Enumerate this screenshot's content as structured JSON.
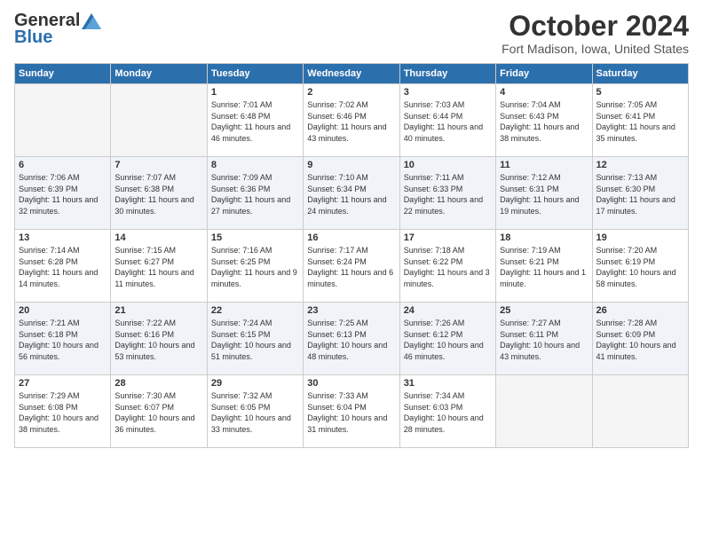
{
  "header": {
    "logo_general": "General",
    "logo_blue": "Blue",
    "month_title": "October 2024",
    "location": "Fort Madison, Iowa, United States"
  },
  "days_of_week": [
    "Sunday",
    "Monday",
    "Tuesday",
    "Wednesday",
    "Thursday",
    "Friday",
    "Saturday"
  ],
  "weeks": [
    [
      {
        "day": "",
        "empty": true
      },
      {
        "day": "",
        "empty": true
      },
      {
        "day": "1",
        "sunrise": "7:01 AM",
        "sunset": "6:48 PM",
        "daylight": "11 hours and 46 minutes."
      },
      {
        "day": "2",
        "sunrise": "7:02 AM",
        "sunset": "6:46 PM",
        "daylight": "11 hours and 43 minutes."
      },
      {
        "day": "3",
        "sunrise": "7:03 AM",
        "sunset": "6:44 PM",
        "daylight": "11 hours and 40 minutes."
      },
      {
        "day": "4",
        "sunrise": "7:04 AM",
        "sunset": "6:43 PM",
        "daylight": "11 hours and 38 minutes."
      },
      {
        "day": "5",
        "sunrise": "7:05 AM",
        "sunset": "6:41 PM",
        "daylight": "11 hours and 35 minutes."
      }
    ],
    [
      {
        "day": "6",
        "sunrise": "7:06 AM",
        "sunset": "6:39 PM",
        "daylight": "11 hours and 32 minutes."
      },
      {
        "day": "7",
        "sunrise": "7:07 AM",
        "sunset": "6:38 PM",
        "daylight": "11 hours and 30 minutes."
      },
      {
        "day": "8",
        "sunrise": "7:09 AM",
        "sunset": "6:36 PM",
        "daylight": "11 hours and 27 minutes."
      },
      {
        "day": "9",
        "sunrise": "7:10 AM",
        "sunset": "6:34 PM",
        "daylight": "11 hours and 24 minutes."
      },
      {
        "day": "10",
        "sunrise": "7:11 AM",
        "sunset": "6:33 PM",
        "daylight": "11 hours and 22 minutes."
      },
      {
        "day": "11",
        "sunrise": "7:12 AM",
        "sunset": "6:31 PM",
        "daylight": "11 hours and 19 minutes."
      },
      {
        "day": "12",
        "sunrise": "7:13 AM",
        "sunset": "6:30 PM",
        "daylight": "11 hours and 17 minutes."
      }
    ],
    [
      {
        "day": "13",
        "sunrise": "7:14 AM",
        "sunset": "6:28 PM",
        "daylight": "11 hours and 14 minutes."
      },
      {
        "day": "14",
        "sunrise": "7:15 AM",
        "sunset": "6:27 PM",
        "daylight": "11 hours and 11 minutes."
      },
      {
        "day": "15",
        "sunrise": "7:16 AM",
        "sunset": "6:25 PM",
        "daylight": "11 hours and 9 minutes."
      },
      {
        "day": "16",
        "sunrise": "7:17 AM",
        "sunset": "6:24 PM",
        "daylight": "11 hours and 6 minutes."
      },
      {
        "day": "17",
        "sunrise": "7:18 AM",
        "sunset": "6:22 PM",
        "daylight": "11 hours and 3 minutes."
      },
      {
        "day": "18",
        "sunrise": "7:19 AM",
        "sunset": "6:21 PM",
        "daylight": "11 hours and 1 minute."
      },
      {
        "day": "19",
        "sunrise": "7:20 AM",
        "sunset": "6:19 PM",
        "daylight": "10 hours and 58 minutes."
      }
    ],
    [
      {
        "day": "20",
        "sunrise": "7:21 AM",
        "sunset": "6:18 PM",
        "daylight": "10 hours and 56 minutes."
      },
      {
        "day": "21",
        "sunrise": "7:22 AM",
        "sunset": "6:16 PM",
        "daylight": "10 hours and 53 minutes."
      },
      {
        "day": "22",
        "sunrise": "7:24 AM",
        "sunset": "6:15 PM",
        "daylight": "10 hours and 51 minutes."
      },
      {
        "day": "23",
        "sunrise": "7:25 AM",
        "sunset": "6:13 PM",
        "daylight": "10 hours and 48 minutes."
      },
      {
        "day": "24",
        "sunrise": "7:26 AM",
        "sunset": "6:12 PM",
        "daylight": "10 hours and 46 minutes."
      },
      {
        "day": "25",
        "sunrise": "7:27 AM",
        "sunset": "6:11 PM",
        "daylight": "10 hours and 43 minutes."
      },
      {
        "day": "26",
        "sunrise": "7:28 AM",
        "sunset": "6:09 PM",
        "daylight": "10 hours and 41 minutes."
      }
    ],
    [
      {
        "day": "27",
        "sunrise": "7:29 AM",
        "sunset": "6:08 PM",
        "daylight": "10 hours and 38 minutes."
      },
      {
        "day": "28",
        "sunrise": "7:30 AM",
        "sunset": "6:07 PM",
        "daylight": "10 hours and 36 minutes."
      },
      {
        "day": "29",
        "sunrise": "7:32 AM",
        "sunset": "6:05 PM",
        "daylight": "10 hours and 33 minutes."
      },
      {
        "day": "30",
        "sunrise": "7:33 AM",
        "sunset": "6:04 PM",
        "daylight": "10 hours and 31 minutes."
      },
      {
        "day": "31",
        "sunrise": "7:34 AM",
        "sunset": "6:03 PM",
        "daylight": "10 hours and 28 minutes."
      },
      {
        "day": "",
        "empty": true
      },
      {
        "day": "",
        "empty": true
      }
    ]
  ],
  "labels": {
    "sunrise_prefix": "Sunrise: ",
    "sunset_prefix": "Sunset: ",
    "daylight_prefix": "Daylight: "
  }
}
